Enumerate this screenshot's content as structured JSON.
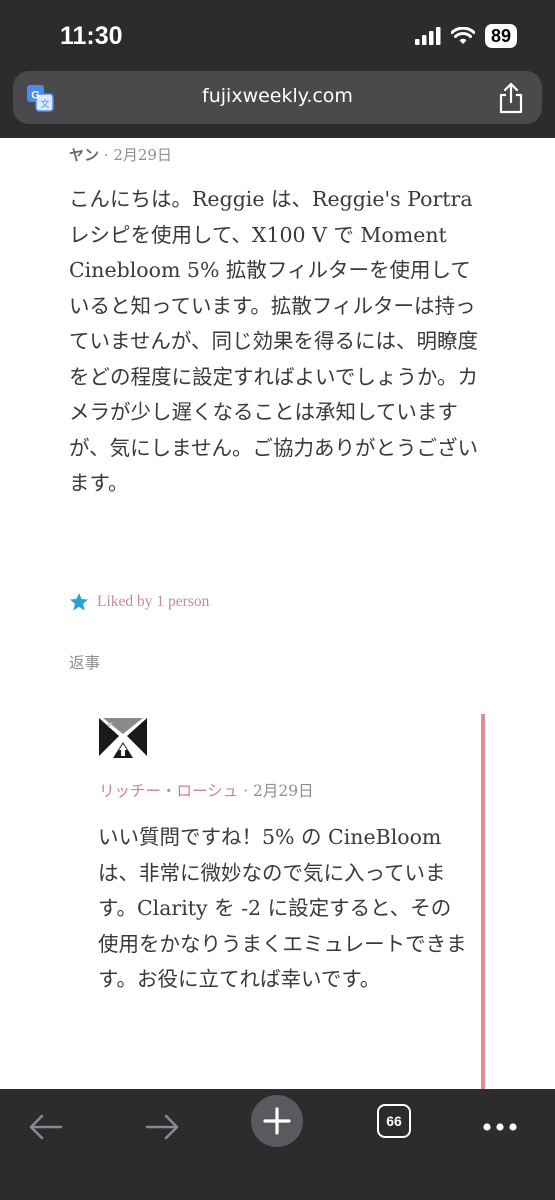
{
  "status_bar": {
    "time": "11:30",
    "battery": "89",
    "icons": [
      "cellular-signal-icon",
      "wifi-icon",
      "battery-icon"
    ]
  },
  "url_bar": {
    "url": "fujixweekly.com",
    "left_icon": "translate-icon",
    "right_icon": "share-icon"
  },
  "comment": {
    "author": "ヤン",
    "separator": " · ",
    "date": "2月29日",
    "body": "こんにちは。Reggie は、Reggie's Portra レシピを使用して、X100 V で Moment Cinebloom 5% 拡散フィルターを使用していると知っています。拡散フィルターは持っていませんが、同じ効果を得るには、明瞭度をどの程度に設定すればよいでしょうか。カメラが少し遅くなることは承知していますが、気にしません。ご協力ありがとうございます。",
    "like_text": "Liked by 1 person",
    "reply_label": "返事"
  },
  "reply": {
    "author": "リッチー・ローシュ",
    "separator": " · ",
    "date": "2月29日",
    "body": "いい質問ですね！5% の CineBloom は、非常に微妙なので気に入っています。Clarity を -2 に設定すると、その使用をかなりうまくエミュレートできます。お役に立てれば幸いです。"
  },
  "toolbar": {
    "tab_count": "66",
    "icons": [
      "back-arrow-icon",
      "forward-arrow-icon",
      "new-tab-plus-icon",
      "tabs-icon",
      "more-icon"
    ]
  },
  "colors": {
    "chrome": "#2c2c2e",
    "accent_pink": "#e08a94",
    "star_blue": "#2e9fd6"
  }
}
